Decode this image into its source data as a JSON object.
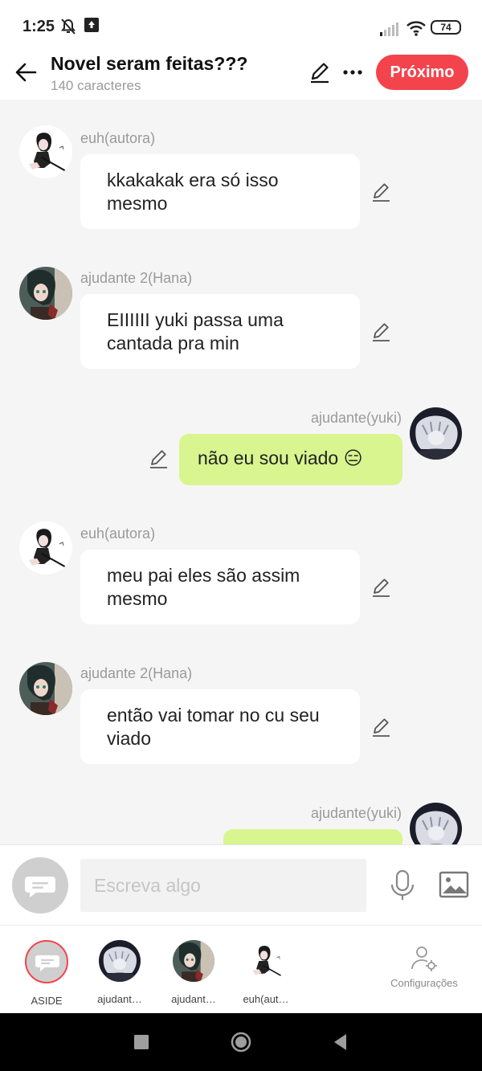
{
  "status": {
    "time": "1:25",
    "battery": "74"
  },
  "header": {
    "title": "Novel seram feitas???",
    "subtitle": "140 caracteres",
    "next_label": "Próximo"
  },
  "messages": [
    {
      "sender": "euh(autora)",
      "text": "kkakakak era só isso mesmo",
      "side": "left",
      "avatar": "author-avatar"
    },
    {
      "sender": "ajudante 2(Hana)",
      "text": "EIIIIII yuki passa uma cantada pra min",
      "side": "left",
      "avatar": "hana-avatar"
    },
    {
      "sender": "ajudante(yuki)",
      "text": "não eu sou viado 😑",
      "side": "right",
      "avatar": "yuki-avatar"
    },
    {
      "sender": "euh(autora)",
      "text": "meu pai eles são assim mesmo",
      "side": "left",
      "avatar": "author-avatar"
    },
    {
      "sender": "ajudante 2(Hana)",
      "text": "então vai tomar no cu seu viado",
      "side": "left",
      "avatar": "hana-avatar"
    },
    {
      "sender": "ajudante(yuki)",
      "text": "",
      "side": "right",
      "avatar": "yuki-avatar"
    }
  ],
  "input": {
    "placeholder": "Escreva algo"
  },
  "characters": [
    {
      "label": "ASIDE",
      "avatar": "aside-icon"
    },
    {
      "label": "ajudant…",
      "avatar": "yuki-avatar"
    },
    {
      "label": "ajudant…",
      "avatar": "hana-avatar"
    },
    {
      "label": "euh(aut…",
      "avatar": "author-avatar"
    }
  ],
  "settings_label": "Configurações",
  "colors": {
    "accent": "#f3444d",
    "mine_bubble": "#d8f58f",
    "chat_bg": "#f5f5f5"
  }
}
